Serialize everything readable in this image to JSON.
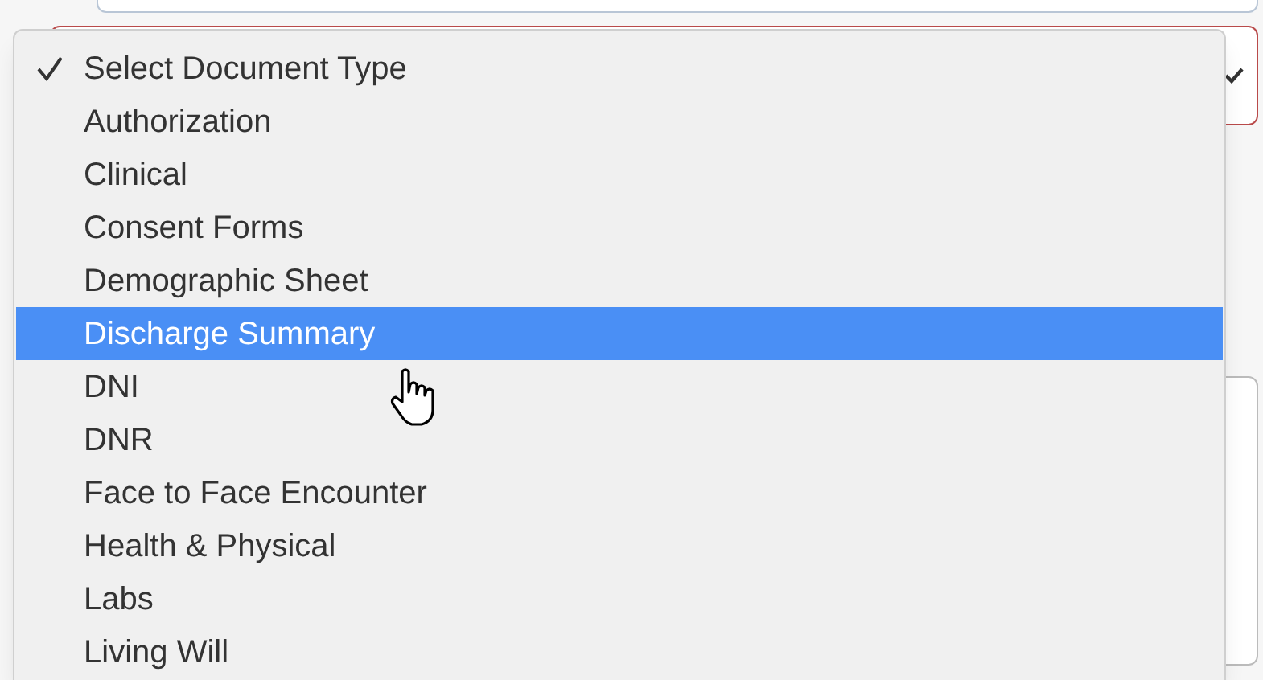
{
  "dropdown": {
    "options": [
      {
        "label": "Select Document Type",
        "selected": false,
        "checked": true
      },
      {
        "label": "Authorization",
        "selected": false,
        "checked": false
      },
      {
        "label": "Clinical",
        "selected": false,
        "checked": false
      },
      {
        "label": "Consent Forms",
        "selected": false,
        "checked": false
      },
      {
        "label": "Demographic Sheet",
        "selected": false,
        "checked": false
      },
      {
        "label": "Discharge Summary",
        "selected": true,
        "checked": false
      },
      {
        "label": "DNI",
        "selected": false,
        "checked": false
      },
      {
        "label": "DNR",
        "selected": false,
        "checked": false
      },
      {
        "label": "Face to Face Encounter",
        "selected": false,
        "checked": false
      },
      {
        "label": "Health & Physical",
        "selected": false,
        "checked": false
      },
      {
        "label": "Labs",
        "selected": false,
        "checked": false
      },
      {
        "label": "Living Will",
        "selected": false,
        "checked": false
      }
    ]
  }
}
